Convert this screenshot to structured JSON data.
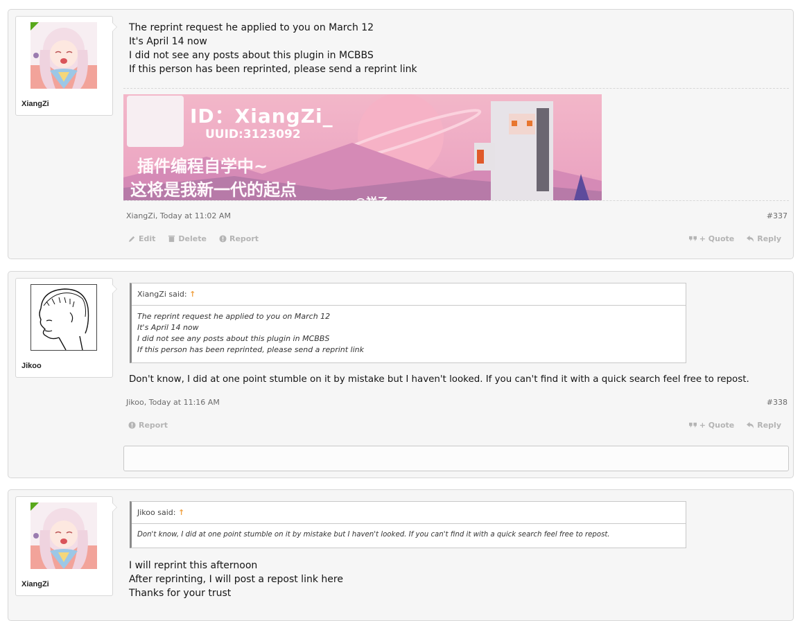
{
  "posts": [
    {
      "username": "XiangZi",
      "lines": [
        "The reprint request he applied to you on March 12",
        "It's April 14 now",
        "I did not see any posts about this plugin in MCBBS",
        "If this person has been reprinted, please send a reprint link"
      ],
      "signature": {
        "id_text": "ID：XiangZi_",
        "uuid_text": "UUID:3123092",
        "cn_line1": "插件编程自学中~",
        "cn_line2": "这将是我新一代的起点",
        "cn_handle": "@祥子"
      },
      "meta": "XiangZi, Today at 11:02 AM",
      "number": "#337",
      "actions_left": [
        "Edit",
        "Delete",
        "Report"
      ],
      "actions_right": [
        "+ Quote",
        "Reply"
      ]
    },
    {
      "username": "Jikoo",
      "quote": {
        "header": "XiangZi said:",
        "arrow": "↑",
        "lines": [
          "The reprint request he applied to you on March 12",
          "It's April 14 now",
          "I did not see any posts about this plugin in MCBBS",
          "If this person has been reprinted, please send a reprint link"
        ]
      },
      "lines": [
        "Don't know, I did at one point stumble on it by mistake but I haven't looked. If you can't find it with a quick search feel free to repost."
      ],
      "meta": "Jikoo, Today at 11:16 AM",
      "number": "#338",
      "actions_left": [
        "Report"
      ],
      "actions_right": [
        "+ Quote",
        "Reply"
      ]
    },
    {
      "username": "XiangZi",
      "quote": {
        "header": "Jikoo said:",
        "arrow": "↑",
        "lines": [
          "Don't know, I did at one point stumble on it by mistake but I haven't looked. If you can't find it with a quick search feel free to repost."
        ]
      },
      "lines": [
        "I will reprint this afternoon",
        "After reprinting, I will post a repost link here",
        "Thanks for your trust"
      ]
    }
  ],
  "colors": {
    "post_bg": "#f6f6f6",
    "border": "#d7d7d7",
    "muted": "#b4b4b4",
    "online_badge": "#59a81c",
    "quote_arrow": "#f0a040"
  },
  "icons": {
    "edit": "pencil-icon",
    "delete": "trash-icon",
    "report": "warning-icon",
    "quote": "quote-icon",
    "reply": "reply-icon"
  }
}
